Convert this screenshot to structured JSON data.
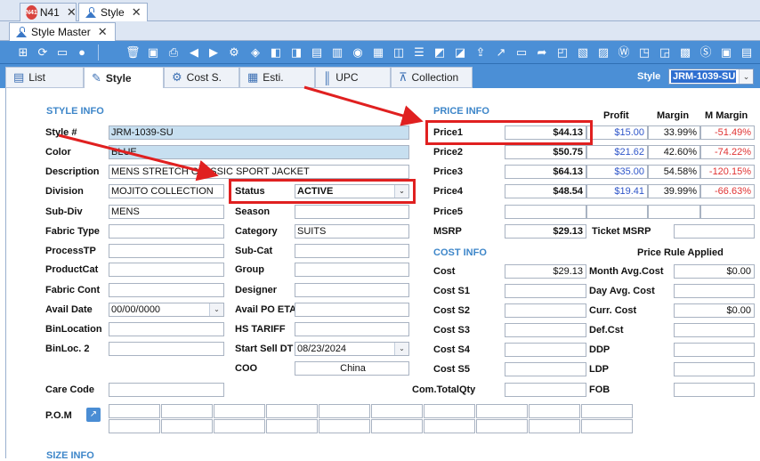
{
  "doc_tabs": [
    {
      "label": "N41",
      "badge": "N41"
    },
    {
      "label": "Style"
    }
  ],
  "sub_tab": {
    "label": "Style Master"
  },
  "section_tabs": [
    "List",
    "Style",
    "Cost S.",
    "Esti.",
    "UPC",
    "Collection"
  ],
  "style_picker": {
    "label": "Style",
    "value": "JRM-1039-SU"
  },
  "style_info": {
    "title": "STYLE INFO",
    "style_no": {
      "label": "Style #",
      "value": "JRM-1039-SU"
    },
    "color": {
      "label": "Color",
      "value": "BLUE"
    },
    "description": {
      "label": "Description",
      "value": "MENS STRETCH CLASSIC SPORT JACKET"
    },
    "division": {
      "label": "Division",
      "value": "MOJITO COLLECTION"
    },
    "sub_div": {
      "label": "Sub-Div",
      "value": "MENS"
    },
    "fabric_type": {
      "label": "Fabric Type",
      "value": ""
    },
    "process_tp": {
      "label": "ProcessTP",
      "value": ""
    },
    "product_cat": {
      "label": "ProductCat",
      "value": ""
    },
    "fabric_cont": {
      "label": "Fabric Cont",
      "value": ""
    },
    "avail_date": {
      "label": "Avail Date",
      "value": "00/00/0000"
    },
    "bin_location": {
      "label": "BinLocation",
      "value": ""
    },
    "bin_loc2": {
      "label": "BinLoc. 2",
      "value": ""
    },
    "care_code": {
      "label": "Care Code",
      "value": ""
    },
    "pom": {
      "label": "P.O.M"
    }
  },
  "mid": {
    "status": {
      "label": "Status",
      "value": "ACTIVE"
    },
    "season": {
      "label": "Season",
      "value": ""
    },
    "category": {
      "label": "Category",
      "value": "SUITS"
    },
    "sub_cat": {
      "label": "Sub-Cat",
      "value": ""
    },
    "group": {
      "label": "Group",
      "value": ""
    },
    "designer": {
      "label": "Designer",
      "value": ""
    },
    "avail_po_eta": {
      "label": "Avail PO ETA",
      "value": ""
    },
    "hs_tariff": {
      "label": "HS TARIFF",
      "value": ""
    },
    "start_sell_dt": {
      "label": "Start Sell DT",
      "value": "08/23/2024"
    },
    "coo": {
      "label": "COO",
      "value": "China"
    }
  },
  "price_info": {
    "title": "PRICE INFO",
    "headers": {
      "profit": "Profit",
      "margin": "Margin",
      "m_margin": "M Margin"
    },
    "rows": [
      {
        "label": "Price1",
        "price": "$44.13",
        "profit": "$15.00",
        "margin": "33.99%",
        "m_margin": "-51.49%"
      },
      {
        "label": "Price2",
        "price": "$50.75",
        "profit": "$21.62",
        "margin": "42.60%",
        "m_margin": "-74.22%"
      },
      {
        "label": "Price3",
        "price": "$64.13",
        "profit": "$35.00",
        "margin": "54.58%",
        "m_margin": "-120.15%"
      },
      {
        "label": "Price4",
        "price": "$48.54",
        "profit": "$19.41",
        "margin": "39.99%",
        "m_margin": "-66.63%"
      },
      {
        "label": "Price5",
        "price": "",
        "profit": "",
        "margin": "",
        "m_margin": ""
      }
    ],
    "msrp": {
      "label": "MSRP",
      "value": "$29.13"
    },
    "ticket_msrp": {
      "label": "Ticket MSRP",
      "value": ""
    },
    "price_rule": "Price Rule Applied"
  },
  "cost_info": {
    "title": "COST INFO",
    "cost": {
      "label": "Cost",
      "value": "$29.13"
    },
    "cost_s1": {
      "label": "Cost S1",
      "value": ""
    },
    "cost_s2": {
      "label": "Cost S2",
      "value": ""
    },
    "cost_s3": {
      "label": "Cost S3",
      "value": ""
    },
    "cost_s4": {
      "label": "Cost S4",
      "value": ""
    },
    "cost_s5": {
      "label": "Cost S5",
      "value": ""
    },
    "com_total_qty": {
      "label": "Com.TotalQty",
      "value": ""
    },
    "month_avg_cost": {
      "label": "Month Avg.Cost",
      "value": "$0.00"
    },
    "day_avg_cost": {
      "label": "Day Avg. Cost",
      "value": ""
    },
    "curr_cost": {
      "label": "Curr. Cost",
      "value": "$0.00"
    },
    "def_cst": {
      "label": "Def.Cst",
      "value": ""
    },
    "ddp": {
      "label": "DDP",
      "value": ""
    },
    "ldp": {
      "label": "LDP",
      "value": ""
    },
    "fob": {
      "label": "FOB",
      "value": ""
    }
  },
  "size_info": {
    "title": "SIZE INFO"
  },
  "colors": {
    "toolbar": "#4b8fd6",
    "section_title": "#3d86c9",
    "highlight": "#e02020",
    "negative": "#e03333",
    "link": "#2f56c9"
  }
}
